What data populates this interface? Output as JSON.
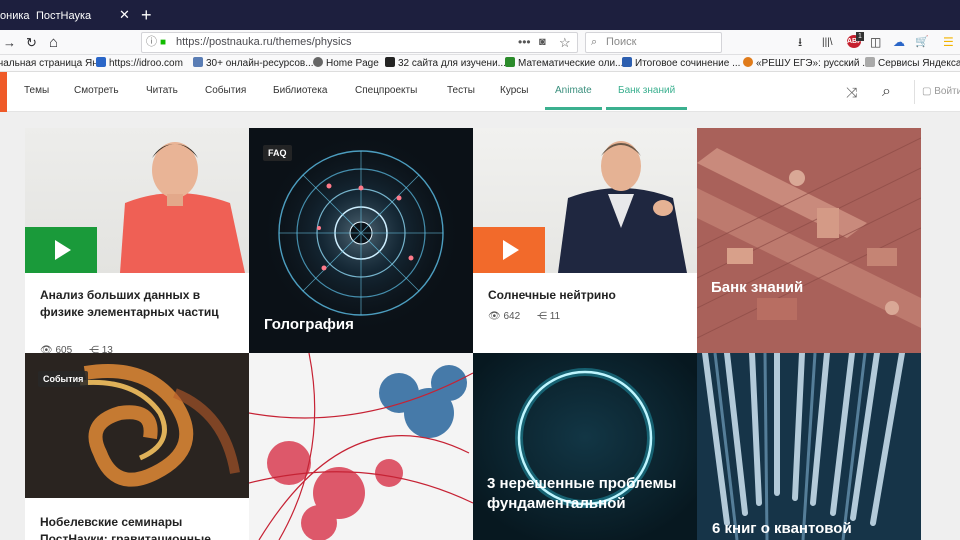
{
  "browser": {
    "tab_previous": "оника",
    "tab_active": "ПостНаука",
    "tab_close": "✕",
    "tab_new": "+",
    "back": "→",
    "reload": "↻",
    "home": "⌂",
    "url": "https://postnauka.ru/themes/physics",
    "url_more": "•••",
    "search_placeholder": "Поиск",
    "notification_badge": "1",
    "tools": {
      "download": "⭳",
      "library": "|||\\",
      "abp": "ABP",
      "sidebar": "◫",
      "sync": "☁",
      "cart": "🛒",
      "menu": "☰"
    }
  },
  "bookmarks": [
    {
      "label": "чальная страница Ян...",
      "color": "#e23b2e"
    },
    {
      "label": "https://idroo.com",
      "color": "#2a66c8"
    },
    {
      "label": "30+ онлайн-ресурсов...",
      "color": "#5a7db5"
    },
    {
      "label": "Home Page",
      "color": "#666666"
    },
    {
      "label": "32 сайта для изучени...",
      "color": "#222222"
    },
    {
      "label": "Математические оли...",
      "color": "#2b8b2b"
    },
    {
      "label": "Итоговое сочинение ...",
      "color": "#2d5fb0"
    },
    {
      "label": "«РЕШУ ЕГЭ»: русский ...",
      "color": "#e07b1a"
    },
    {
      "label": "Сервисы Яндекса",
      "color": "#999999"
    }
  ],
  "site_nav": {
    "items": [
      "Темы",
      "Смотреть",
      "Читать",
      "События",
      "Библиотека",
      "Спецпроекты",
      "Тесты",
      "Курсы",
      "Animate",
      "Банк знаний"
    ],
    "login": "Войти"
  },
  "cards": [
    {
      "title": "Анализ больших данных в физике элементарных частиц",
      "views": "605",
      "shares": "13",
      "play_color": "#1a9a3a"
    },
    {
      "tag": "FAQ",
      "title": "Голография"
    },
    {
      "title": "Солнечные нейтрино",
      "views": "642",
      "shares": "11",
      "play_color": "#f26a2b"
    },
    {
      "title": "Банк знаний"
    },
    {
      "tag": "События",
      "title": "Нобелевские семинары ПостНауки: гравитационные"
    },
    {
      "title": ""
    },
    {
      "title": "3 нерешенные проблемы фундаментальной"
    },
    {
      "title": "6 книг о квантовой"
    }
  ],
  "colors": {
    "accent_orange": "#ef5a28",
    "accent_green": "#3bb08f"
  }
}
